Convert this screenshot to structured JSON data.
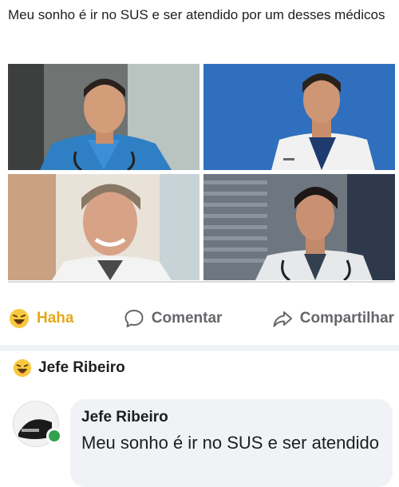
{
  "post": {
    "text": "Meu sonho é ir no SUS e ser atendido por um desses médicos"
  },
  "actions": {
    "haha_label": "Haha",
    "comment_label": "Comentar",
    "share_label": "Compartilhar"
  },
  "reaction": {
    "user_name": "Jefe Ribeiro"
  },
  "comment": {
    "author": "Jefe Ribeiro",
    "text": "Meu sonho é ir no SUS e ser atendido"
  },
  "colors": {
    "haha": "#e6a81a",
    "action_gray": "#65676b",
    "online": "#31a24c",
    "bubble": "#f0f2f5"
  },
  "icons": [
    "haha-emoji-icon",
    "comment-icon",
    "share-icon",
    "online-indicator"
  ]
}
